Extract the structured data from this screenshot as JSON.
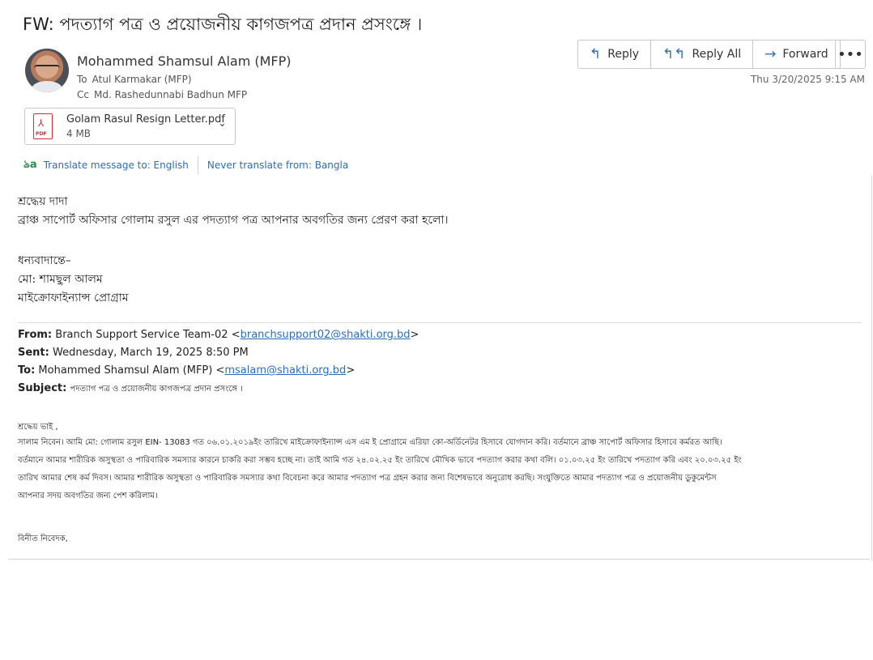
{
  "message": {
    "subject": "FW: পদত্যাগ পত্র ও প্রয়োজনীয় কাগজপত্র প্রদান প্রসংঙ্গে ।",
    "sender": "Mohammed  Shamsul Alam (MFP)",
    "to_label": "To",
    "to": "Atul  Karmakar (MFP)",
    "cc_label": "Cc",
    "cc": "Md. Rashedunnabi Badhun MFP",
    "date": "Thu 3/20/2025 9:15 AM"
  },
  "actions": {
    "reply": "Reply",
    "reply_all": "Reply All",
    "forward": "Forward",
    "more": "•••"
  },
  "attachment": {
    "name": "Golam Rasul Resign Letter.pdf",
    "size": "4 MB",
    "type_label": "PDF"
  },
  "translate": {
    "translate_to": "Translate message to: English",
    "never": "Never translate from: Bangla"
  },
  "body": {
    "greeting": "শ্রদ্ধেয় দাদা",
    "line1": "ব্রাঞ্চ সাপোর্ট অফিসার গোলাম রসুল এর পদত্যাগ পত্র  আপনার অবগতির জন্য প্রেরণ করা হলো।",
    "closing": "ধন্যবাদান্তে–",
    "name": "মো: শামছুল আলম",
    "program": "মাইক্রোফাইন্যান্স প্রোগ্রাম"
  },
  "forwarded": {
    "from_label": "From:",
    "from_name": "Branch Support Service Team-02 <",
    "from_email": "branchsupport02@shakti.org.bd",
    "from_close": ">",
    "sent_label": "Sent:",
    "sent": "Wednesday, March 19, 2025 8:50 PM",
    "to_label": "To:",
    "to_name": "Mohammed Shamsul Alam (MFP) <",
    "to_email": "msalam@shakti.org.bd",
    "to_close": ">",
    "subject_label": "Subject:",
    "subject": "পদত্যাগ পত্র ও প্রয়োজনীয় কাগজপত্র প্রদান প্রসংঙ্গে ।",
    "greeting": "শ্রদ্ধেয় ভাই ,",
    "para": [
      "সালাম নিবেন। আমি মো: গোলাম রসুল EIN- 13083 গত ০৬.০১.২০১৯ইং তারিখে মাইক্রোফাইন্যান্স এস এম ই প্রোগ্রামে এরিয়া কো-অর্ডিনেটর হিসাবে যোগদান করি। বর্তমানে ব্রাঞ্চ সাপোর্ট অফিসার হিসাবে কর্মরত আছি।",
      "বর্তমানে আমার শারীরিক অসুস্থতা ও পারিবারিক সমস্যার কারনে চাকরি করা সম্ভব হচ্ছে না। তাই আমি গত ২৪.০২.২৫ ইং তারিখে মৌখিক ভাবে পদত্যাগ করার কথা বলি। ০১.০৩.২৫ ইং তারিখে পদত্যাগ করি এবং ২০.০৩.২৫ ইং",
      "তারিখ আমার শেষ কর্ম দিবস। আমার শারীরিক অসুস্থতা ও পারিবারিক সমস্যার কথা বিবেচনা করে আমার পদত্যাগ পত্র গ্রহন করার জন্য বিশেষভাবে অনুরোধ করছি। সংযুক্তিতে আমার  পদত্যাগ পত্র ও প্রয়োজনীয় ডুকুমেন্টস",
      "আপনার সদয় অবগতির জন্য পেশ করিলাম।"
    ],
    "signoff": "বিনীত নিবেদক,"
  }
}
